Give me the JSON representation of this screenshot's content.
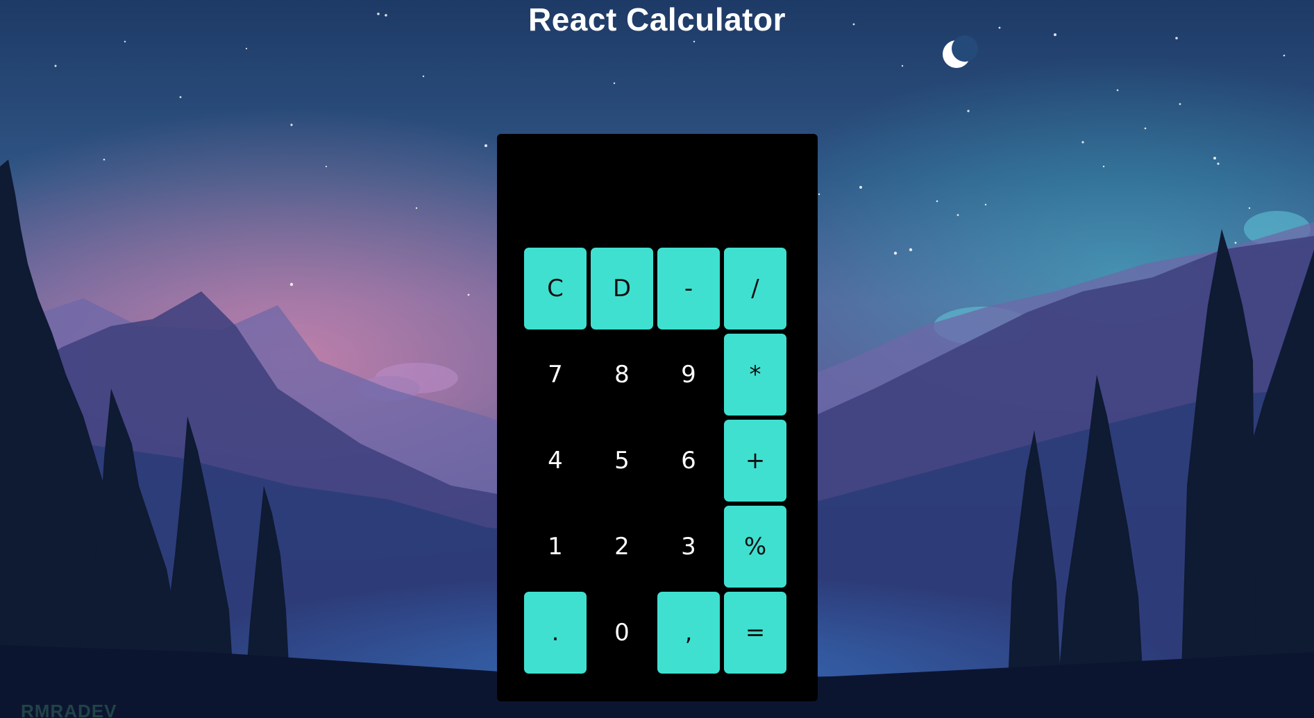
{
  "app": {
    "title": "React Calculator",
    "watermark": "RMRADEV"
  },
  "colors": {
    "key_accent": "#40e0d0",
    "calculator_body": "#000000",
    "title_text": "#ffffff"
  },
  "display": {
    "value": ""
  },
  "keys": [
    {
      "label": "C",
      "name": "clear-button",
      "style": "teal"
    },
    {
      "label": "D",
      "name": "delete-button",
      "style": "teal"
    },
    {
      "label": "-",
      "name": "minus-button",
      "style": "teal"
    },
    {
      "label": "/",
      "name": "divide-button",
      "style": "teal"
    },
    {
      "label": "7",
      "name": "digit-7-button",
      "style": "plain"
    },
    {
      "label": "8",
      "name": "digit-8-button",
      "style": "plain"
    },
    {
      "label": "9",
      "name": "digit-9-button",
      "style": "plain"
    },
    {
      "label": "*",
      "name": "multiply-button",
      "style": "teal"
    },
    {
      "label": "4",
      "name": "digit-4-button",
      "style": "plain"
    },
    {
      "label": "5",
      "name": "digit-5-button",
      "style": "plain"
    },
    {
      "label": "6",
      "name": "digit-6-button",
      "style": "plain"
    },
    {
      "label": "+",
      "name": "plus-button",
      "style": "teal"
    },
    {
      "label": "1",
      "name": "digit-1-button",
      "style": "plain"
    },
    {
      "label": "2",
      "name": "digit-2-button",
      "style": "plain"
    },
    {
      "label": "3",
      "name": "digit-3-button",
      "style": "plain"
    },
    {
      "label": "%",
      "name": "percent-button",
      "style": "teal"
    },
    {
      "label": ".",
      "name": "decimal-point-button",
      "style": "teal"
    },
    {
      "label": "0",
      "name": "digit-0-button",
      "style": "plain"
    },
    {
      "label": ",",
      "name": "comma-button",
      "style": "teal"
    },
    {
      "label": "=",
      "name": "equals-button",
      "style": "teal"
    }
  ]
}
